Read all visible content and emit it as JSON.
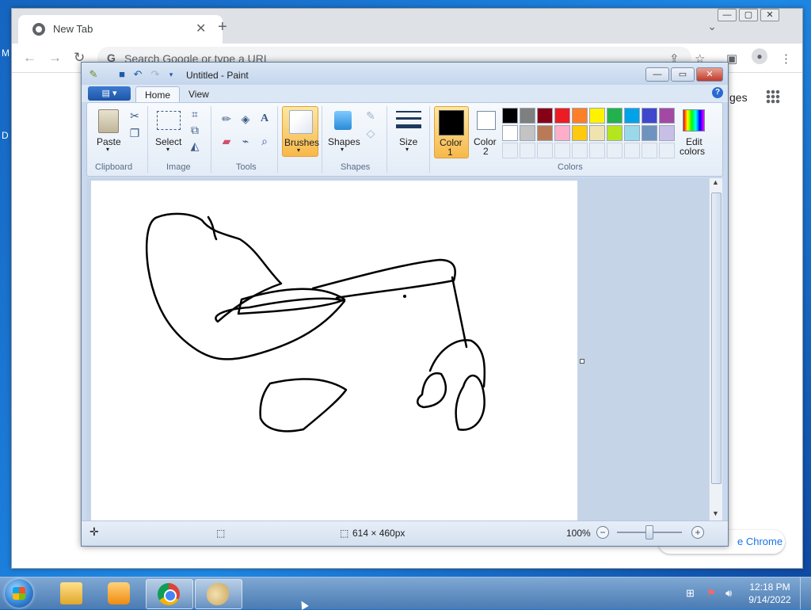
{
  "desktop": {
    "frag_left_top": "M",
    "frag_left_mid": "D"
  },
  "chrome": {
    "tab_title": "New Tab",
    "tab_close": "✕",
    "new_tab": "+",
    "back": "←",
    "forward": "→",
    "reload": "↻",
    "omnibox_g": "G",
    "omnibox_placeholder": "Search Google or type a URL",
    "images_link": "ges",
    "customize_label": "e Chrome",
    "window_controls": [
      "—",
      "▢",
      "✕"
    ],
    "tab_list": "⌄"
  },
  "paint": {
    "window_title": "Untitled - Paint",
    "title_buttons": [
      "—",
      "▭",
      "✕"
    ],
    "tabs": [
      "Home",
      "View"
    ],
    "file_menu": "▤ ▾",
    "help": "?",
    "groups": {
      "clipboard": "Clipboard",
      "image": "Image",
      "tools": "Tools",
      "shapes": "Shapes",
      "colors": "Colors"
    },
    "buttons": {
      "paste": "Paste",
      "select": "Select",
      "brushes": "Brushes",
      "shapes": "Shapes",
      "size": "Size",
      "color1_line1": "Color",
      "color1_line2": "1",
      "color2_line1": "Color",
      "color2_line2": "2",
      "edit_colors_line1": "Edit",
      "edit_colors_line2": "colors"
    },
    "palette_row1": [
      "#000000",
      "#7f7f7f",
      "#880015",
      "#ed1c24",
      "#ff7f27",
      "#fff200",
      "#22b14c",
      "#00a2e8",
      "#3f48cc",
      "#a349a4"
    ],
    "palette_row2": [
      "#ffffff",
      "#c3c3c3",
      "#b97a57",
      "#ffaec9",
      "#ffc90e",
      "#efe4b0",
      "#b5e61d",
      "#99d9ea",
      "#7092be",
      "#c8bfe7"
    ],
    "color1": "#000000",
    "color2": "#ffffff",
    "status": {
      "dimensions": "614 × 460px",
      "zoom": "100%",
      "zoom_out": "−",
      "zoom_in": "+"
    }
  },
  "taskbar": {
    "time": "12:18 PM",
    "date": "9/14/2022"
  }
}
